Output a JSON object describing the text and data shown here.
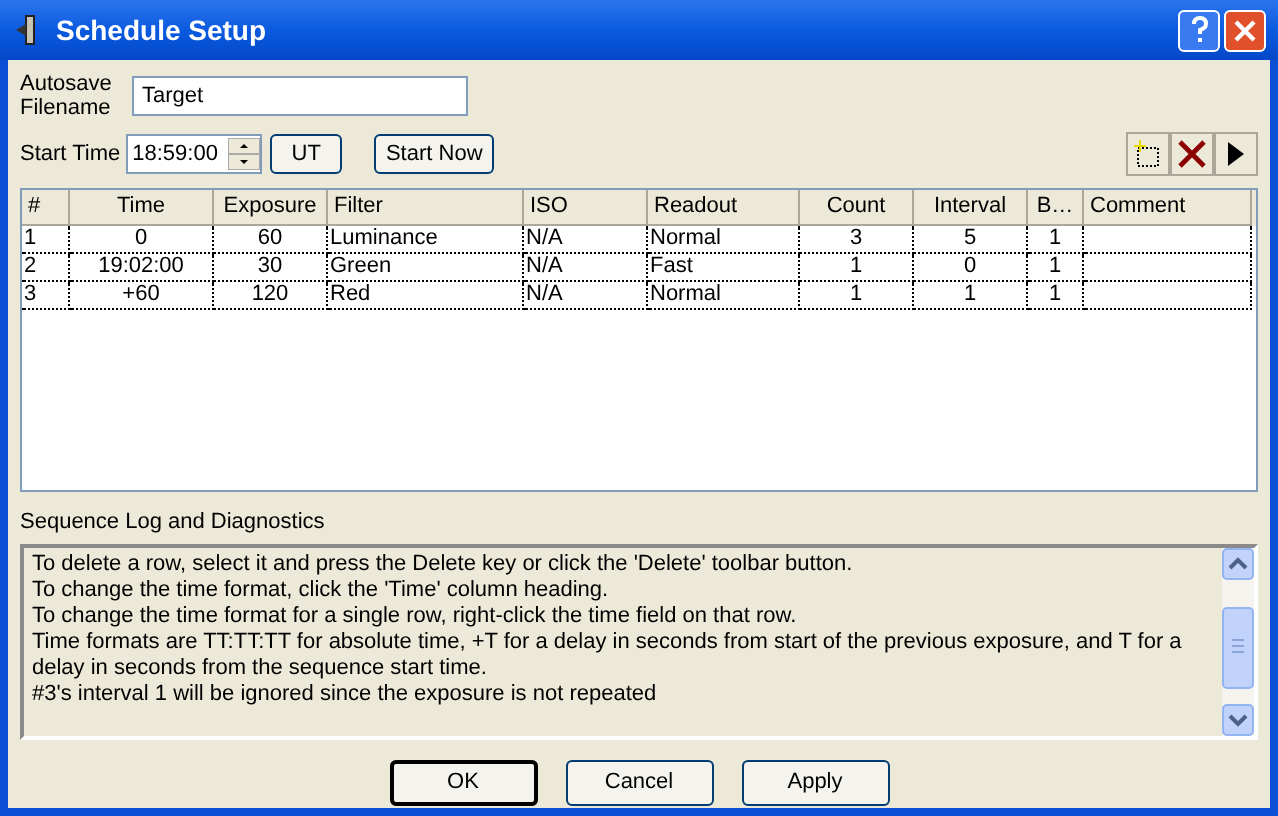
{
  "window": {
    "title": "Schedule Setup"
  },
  "autosave": {
    "label": "Autosave Filename",
    "value": "Target"
  },
  "start_time": {
    "label": "Start Time",
    "value": "18:59:00",
    "ut_button": "UT",
    "start_now_button": "Start Now"
  },
  "table": {
    "columns": [
      "#",
      "Time",
      "Exposure",
      "Filter",
      "ISO",
      "Readout",
      "Count",
      "Interval",
      "B…",
      "Comment"
    ],
    "rows": [
      [
        "1",
        "0",
        "60",
        "Luminance",
        "N/A",
        "Normal",
        "3",
        "5",
        "1",
        ""
      ],
      [
        "2",
        "19:02:00",
        "30",
        "Green",
        "N/A",
        "Fast",
        "1",
        "0",
        "1",
        ""
      ],
      [
        "3",
        "+60",
        "120",
        "Red",
        "N/A",
        "Normal",
        "1",
        "1",
        "1",
        ""
      ]
    ]
  },
  "log": {
    "label": "Sequence Log and Diagnostics",
    "lines": [
      "To delete a row, select it and press the Delete key or click the 'Delete' toolbar button.",
      "To change the time format, click the 'Time' column heading.",
      "To change the time format for a single row, right-click the time field on that row.",
      "Time formats are TT:TT:TT for absolute time, +T for a delay in seconds from start of the previous exposure, and T for a delay in seconds from the sequence start time.",
      "#3's interval 1 will be ignored since the exposure is not repeated"
    ]
  },
  "buttons": [
    "OK",
    "Cancel",
    "Apply"
  ]
}
